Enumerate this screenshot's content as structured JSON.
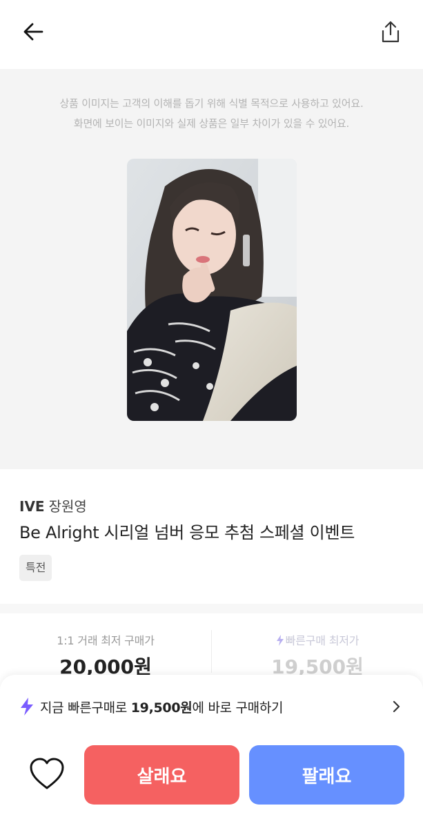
{
  "header": {
    "back_icon": "arrow-left-icon",
    "share_icon": "share-icon"
  },
  "image_section": {
    "disclaimer_line1": "상품 이미지는 고객의 이해를 돕기 위해 식별 목적으로 사용하고 있어요.",
    "disclaimer_line2": "화면에 보이는 이미지와 실제 상품은 일부 차이가 있을 수 있어요.",
    "photo_icon": "product-photo"
  },
  "product": {
    "group": "IVE",
    "member": "장원영",
    "title": "Be Alright 시리얼 넘버 응모 추첨 스페셜 이벤트",
    "tag": "특전"
  },
  "prices": {
    "direct_label": "1:1 거래 최저 구매가",
    "direct_value": "20,000원",
    "fast_label": "빠른구매 최저가",
    "fast_value": "19,500원"
  },
  "bottom": {
    "quick_prefix": "지금 빠른구매로 ",
    "quick_price": "19,500원",
    "quick_suffix": "에 바로 구매하기",
    "buy_label": "살래요",
    "sell_label": "팔래요"
  },
  "colors": {
    "buy": "#f56161",
    "sell": "#6690ff",
    "bolt": "#7a5cff"
  }
}
